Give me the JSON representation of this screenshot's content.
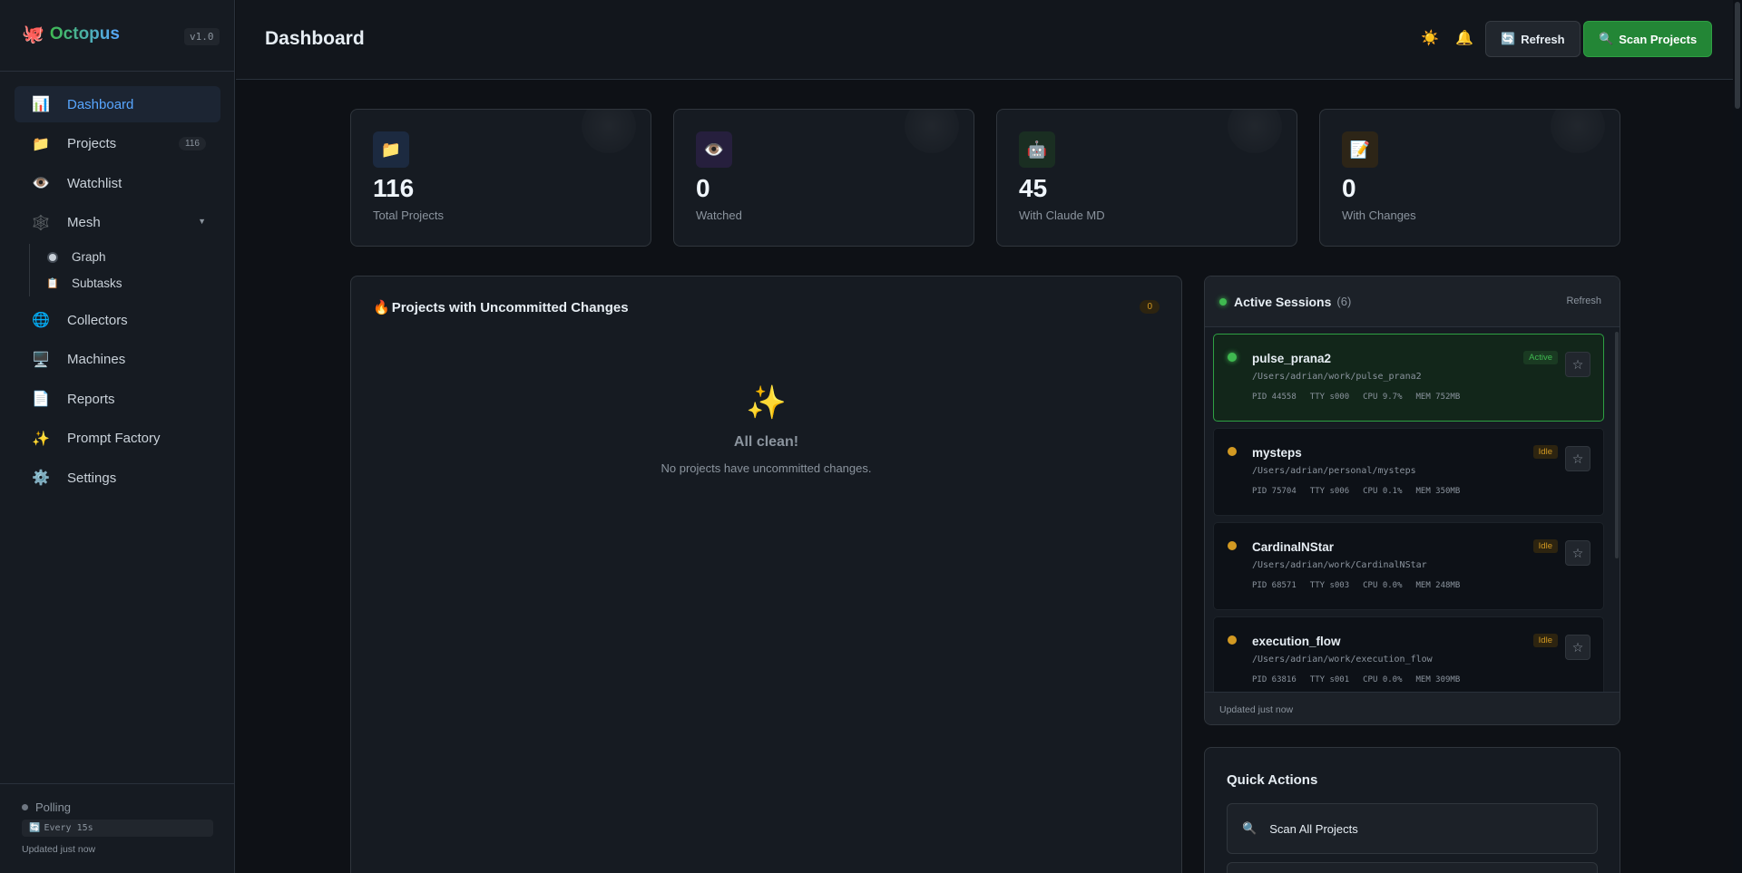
{
  "app": {
    "name": "Octopus",
    "version": "v1.0",
    "logo_icon": "🐙"
  },
  "sidebar": {
    "items": [
      {
        "label": "Dashboard",
        "icon": "📊",
        "active": true
      },
      {
        "label": "Projects",
        "icon": "📁",
        "badge": "116"
      },
      {
        "label": "Watchlist",
        "icon": "👁️"
      },
      {
        "label": "Mesh",
        "icon": "🕸️",
        "chevron": "▼",
        "children": [
          {
            "label": "Graph",
            "icon": "dot"
          },
          {
            "label": "Subtasks",
            "icon": "📋"
          }
        ]
      },
      {
        "label": "Collectors",
        "icon": "🌐"
      },
      {
        "label": "Machines",
        "icon": "🖥️"
      },
      {
        "label": "Reports",
        "icon": "📄"
      },
      {
        "label": "Prompt Factory",
        "icon": "✨"
      },
      {
        "label": "Settings",
        "icon": "⚙️"
      }
    ],
    "footer": {
      "status": "Polling",
      "interval_icon": "🔄",
      "interval": "Every 15s",
      "updated": "Updated just now"
    }
  },
  "header": {
    "title": "Dashboard",
    "theme_icon": "☀️",
    "bell_icon": "🔔",
    "refresh_icon": "🔄",
    "refresh_label": "Refresh",
    "scan_icon": "🔍",
    "scan_label": "Scan Projects"
  },
  "stats": [
    {
      "icon": "📁",
      "value": "116",
      "label": "Total Projects",
      "bg": "#1c2a40"
    },
    {
      "icon": "👁️",
      "value": "0",
      "label": "Watched",
      "bg": "#261f3d"
    },
    {
      "icon": "🤖",
      "value": "45",
      "label": "With Claude MD",
      "bg": "#1a2e22"
    },
    {
      "icon": "📝",
      "value": "0",
      "label": "With Changes",
      "bg": "#2d2517"
    }
  ],
  "changes": {
    "icon": "🔥",
    "title": "Projects with Uncommitted Changes",
    "count": "0",
    "empty_icon": "✨",
    "empty_title": "All clean!",
    "empty_text": "No projects have uncommitted changes."
  },
  "sessions": {
    "title": "Active Sessions",
    "count": "(6)",
    "refresh_label": "Refresh",
    "star_icon": "☆",
    "items": [
      {
        "name": "pulse_prana2",
        "path": "/Users/adrian/work/pulse_prana2",
        "status": "Active",
        "pid": "PID 44558",
        "tty": "TTY s000",
        "cpu": "CPU 9.7%",
        "mem": "MEM 752MB"
      },
      {
        "name": "mysteps",
        "path": "/Users/adrian/personal/mysteps",
        "status": "Idle",
        "pid": "PID 75704",
        "tty": "TTY s006",
        "cpu": "CPU 0.1%",
        "mem": "MEM 350MB"
      },
      {
        "name": "CardinalNStar",
        "path": "/Users/adrian/work/CardinalNStar",
        "status": "Idle",
        "pid": "PID 68571",
        "tty": "TTY s003",
        "cpu": "CPU 0.0%",
        "mem": "MEM 248MB"
      },
      {
        "name": "execution_flow",
        "path": "/Users/adrian/work/execution_flow",
        "status": "Idle",
        "pid": "PID 63816",
        "tty": "TTY s001",
        "cpu": "CPU 0.0%",
        "mem": "MEM 309MB"
      }
    ],
    "footer": "Updated just now"
  },
  "quick_actions": {
    "title": "Quick Actions",
    "items": [
      {
        "icon": "🔍",
        "label": "Scan All Projects"
      }
    ]
  }
}
